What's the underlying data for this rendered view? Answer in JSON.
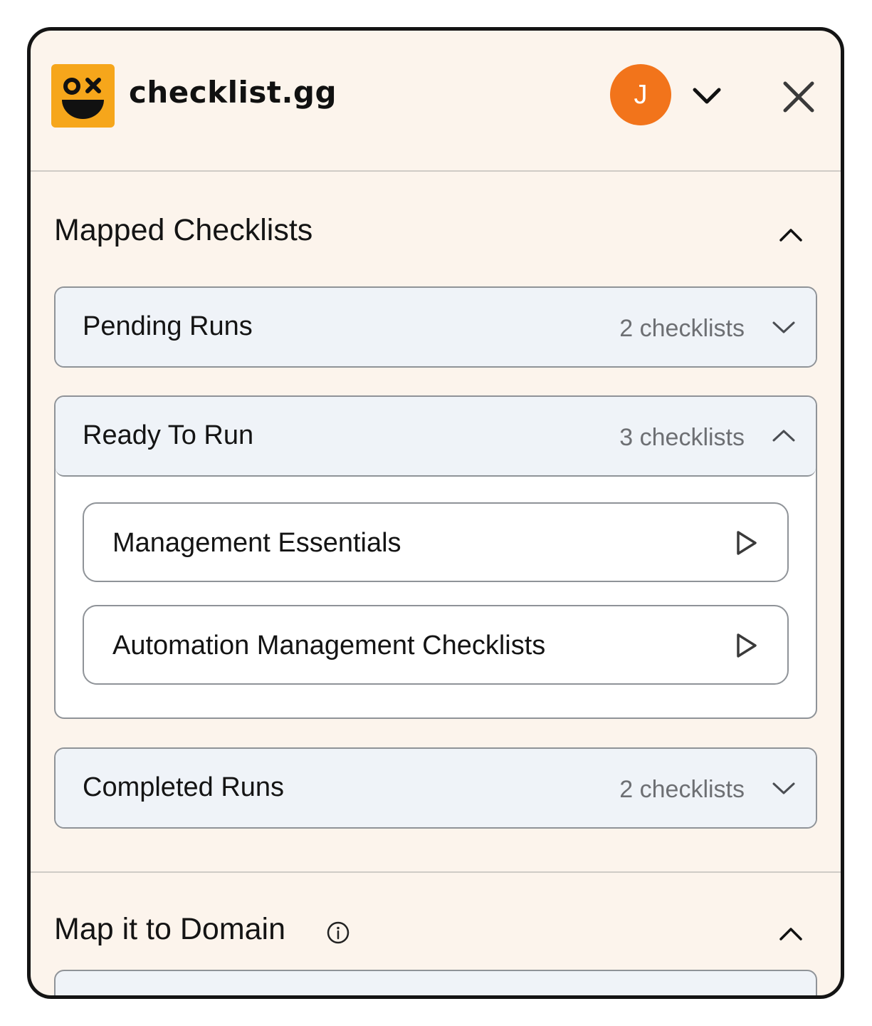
{
  "header": {
    "brand": "checklist.gg",
    "avatar_initial": "J",
    "logo_color": "#f6a61b",
    "avatar_color": "#f2741b"
  },
  "mapped": {
    "title": "Mapped Checklists",
    "groups": [
      {
        "name": "Pending Runs",
        "count": "2 checklists",
        "expanded": false
      },
      {
        "name": "Ready To Run",
        "count": "3 checklists",
        "expanded": true,
        "items": [
          {
            "name": "Management Essentials"
          },
          {
            "name": "Automation Management Checklists"
          }
        ]
      },
      {
        "name": "Completed Runs",
        "count": "2 checklists",
        "expanded": false
      }
    ]
  },
  "domain": {
    "title": "Map it to Domain"
  }
}
